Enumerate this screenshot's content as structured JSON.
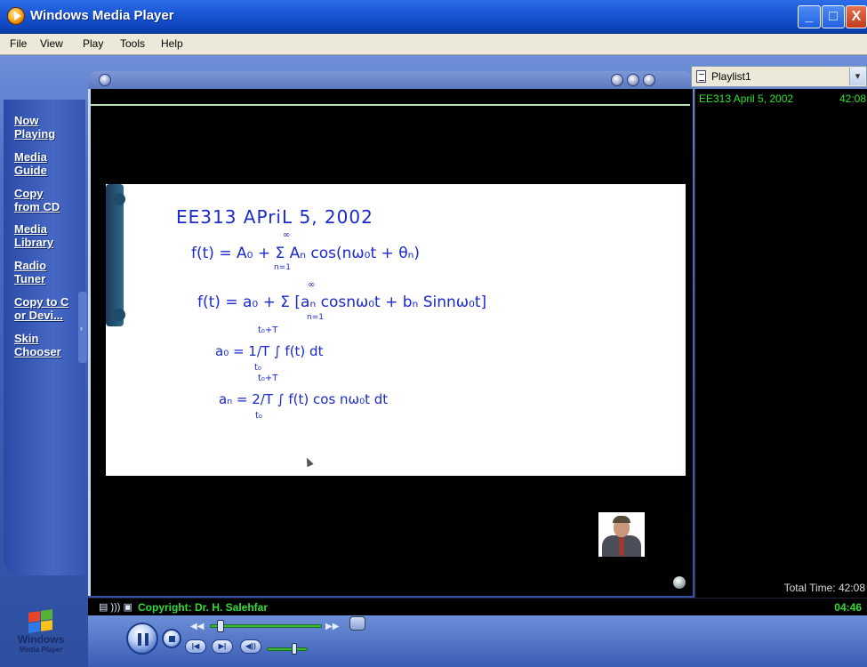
{
  "window": {
    "title": "Windows Media Player",
    "minimize": "_",
    "maximize": "□",
    "close": "X"
  },
  "menu": [
    "File",
    "View",
    "Play",
    "Tools",
    "Help"
  ],
  "taskbar": [
    {
      "line1": "Now",
      "line2": "Playing"
    },
    {
      "line1": "Media",
      "line2": "Guide"
    },
    {
      "line1": "Copy",
      "line2": "from CD"
    },
    {
      "line1": "Media",
      "line2": "Library"
    },
    {
      "line1": "Radio",
      "line2": "Tuner"
    },
    {
      "line1": "Copy to C",
      "line2": "or Devi..."
    },
    {
      "line1": "Skin",
      "line2": "Chooser"
    }
  ],
  "playlist": {
    "name": "Playlist1",
    "items": [
      {
        "title": "EE313 April 5, 2002",
        "duration": "42:08"
      }
    ],
    "total": "Total Time: 42:08"
  },
  "status": {
    "icons": "▤ ))) ▣",
    "text": "Copyright: Dr. H. Salehfar",
    "time": "04:46"
  },
  "slide": {
    "heading": "EE313  APriL  5, 2002",
    "eq1": "f(t) = A₀ + Σ Aₙ cos(nω₀t + θₙ)",
    "eq2": "f(t) =  a₀  +  Σ [aₙ cosnω₀t + bₙ Sinnω₀t]",
    "eq3": "a₀ = 1/T ∫ f(t) dt",
    "eq4": "aₙ = 2/T ∫ f(t) cos nω₀t dt",
    "sum_top": "∞",
    "sum_bottom": "n=1",
    "int_top": "t₀+T",
    "int_bottom": "t₀"
  },
  "logo": {
    "line1": "Windows",
    "line2": "Media Player"
  },
  "transport": {
    "prev": "|◀",
    "next": "▶|",
    "mute": "◀))",
    "rew": "◀◀",
    "ffwd": "▶▶"
  },
  "colors": {
    "accent_green": "#33dd33",
    "chrome_blue": "#3a5fb8",
    "ink": "#1a2ad0"
  }
}
